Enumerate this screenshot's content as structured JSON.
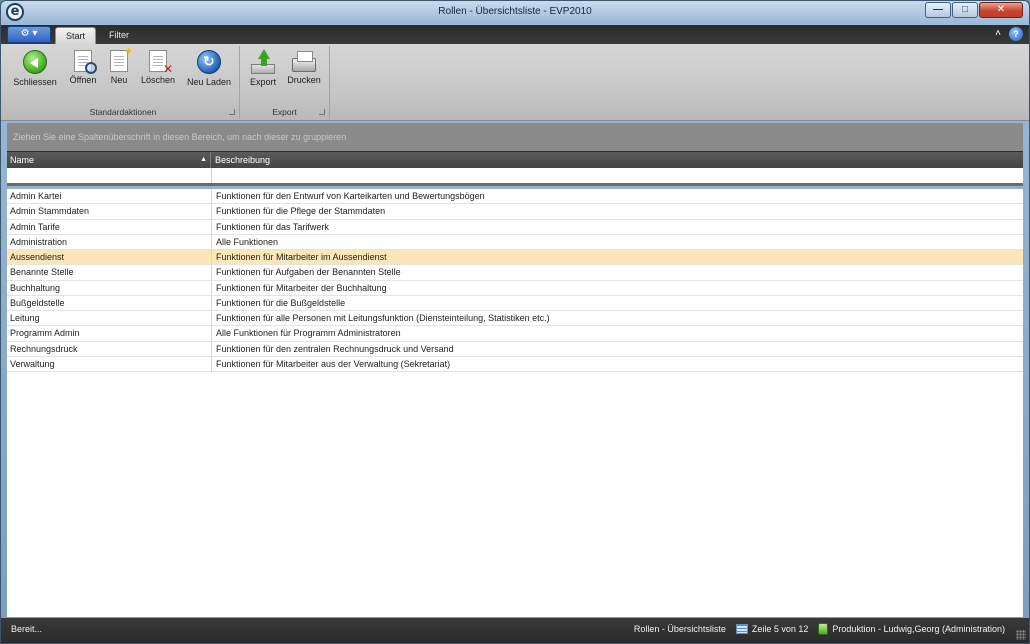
{
  "window": {
    "title": "Rollen - Übersichtsliste - EVP2010",
    "app_logo_text": "e",
    "controls": {
      "minimize": "—",
      "maximize": "□",
      "close": "✕"
    }
  },
  "tabs": {
    "app_menu": "⚙ ▾",
    "items": [
      {
        "label": "Start",
        "active": true
      },
      {
        "label": "Filter",
        "active": false
      }
    ],
    "minimize_ribbon": "˄",
    "help": "?"
  },
  "ribbon": {
    "groups": [
      {
        "label": "Standardaktionen",
        "buttons": [
          {
            "label": "Schliessen",
            "icon": "back-icon"
          },
          {
            "label": "Öffnen",
            "icon": "open-document-icon"
          },
          {
            "label": "Neu",
            "icon": "new-document-icon"
          },
          {
            "label": "Löschen",
            "icon": "delete-document-icon"
          },
          {
            "label": "Neu Laden",
            "icon": "reload-icon"
          }
        ]
      },
      {
        "label": "Export",
        "buttons": [
          {
            "label": "Export",
            "icon": "export-icon"
          },
          {
            "label": "Drucken",
            "icon": "print-icon"
          }
        ]
      }
    ]
  },
  "grid": {
    "group_hint": "Ziehen Sie eine Spaltenüberschrift in diesen Bereich, um nach dieser zu gruppieren",
    "columns": {
      "name": "Name",
      "name_sort": "▲",
      "description": "Beschreibung"
    },
    "rows": [
      {
        "name": "Admin Kartei",
        "description": "Funktionen für den Entwurf von Karteikarten und Bewertungsbögen"
      },
      {
        "name": "Admin Stammdaten",
        "description": "Funktionen für die Pflege der Stammdaten"
      },
      {
        "name": "Admin Tarife",
        "description": "Funktionen für das Tarifwerk"
      },
      {
        "name": "Administration",
        "description": "Alle Funktionen"
      },
      {
        "name": "Aussendienst",
        "description": "Funktionen für Mitarbeiter im Aussendienst",
        "selected": true
      },
      {
        "name": "Benannte Stelle",
        "description": "Funktionen für Aufgaben der Benannten Stelle"
      },
      {
        "name": "Buchhaltung",
        "description": "Funktionen für Mitarbeiter der Buchhaltung"
      },
      {
        "name": "Bußgeldstelle",
        "description": "Funktionen für die Bußgeldstelle"
      },
      {
        "name": "Leitung",
        "description": "Funktionen für alle Personen mit Leitungsfunktion (Diensteinteilung, Statistiken etc.)"
      },
      {
        "name": "Programm Admin",
        "description": "Alle Funktionen für Programm Administratoren"
      },
      {
        "name": "Rechnungsdruck",
        "description": "Funktionen für den zentralen Rechnungsdruck und Versand"
      },
      {
        "name": "Verwaltung",
        "description": "Funktionen für Mitarbeiter aus der Verwaltung (Sekretariat)"
      }
    ]
  },
  "statusbar": {
    "ready": "Bereit...",
    "view": "Rollen - Übersichtsliste",
    "row_position": "Zeile 5 von 12",
    "connection": "Produktion - Ludwig,Georg (Administration)"
  }
}
